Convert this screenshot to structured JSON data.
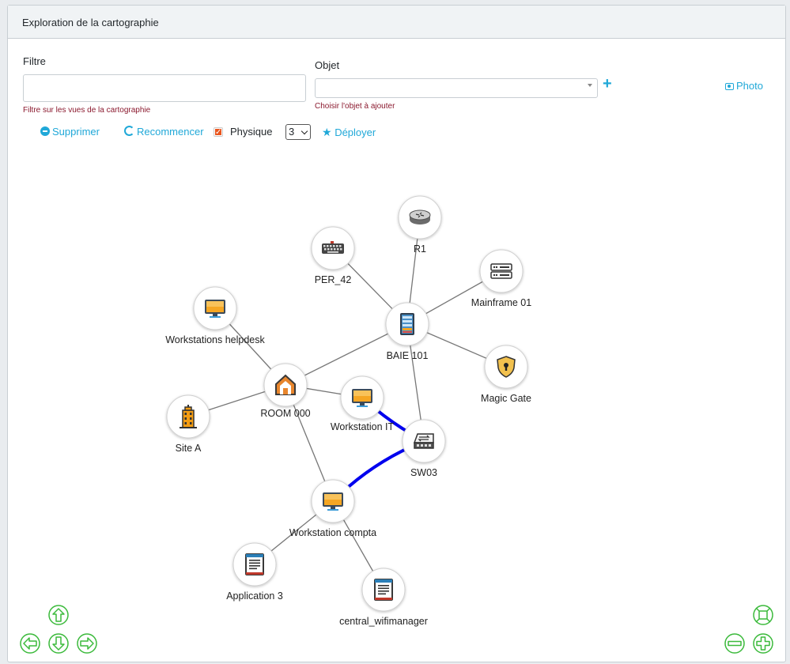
{
  "header": {
    "title": "Exploration de la cartographie"
  },
  "filter": {
    "label": "Filtre",
    "value": "",
    "help": "Filtre sur les vues de la cartographie"
  },
  "object": {
    "label": "Objet",
    "value": "",
    "help": "Choisir l'objet à ajouter"
  },
  "add_button": "+",
  "photo_button": "Photo",
  "toolbar": {
    "delete_label": "Supprimer",
    "restart_label": "Recommencer",
    "physical_label": "Physique",
    "physical_checked": true,
    "depth_value": "3",
    "deploy_label": "Déployer"
  },
  "graph": {
    "nodes": [
      {
        "id": "r1",
        "label": "R1",
        "icon": "router-icon"
      },
      {
        "id": "per42",
        "label": "PER_42",
        "icon": "keyboard-icon"
      },
      {
        "id": "mainframe",
        "label": "Mainframe 01",
        "icon": "server-icon"
      },
      {
        "id": "wshelp",
        "label": "Workstations helpdesk",
        "icon": "monitor-icon"
      },
      {
        "id": "baie",
        "label": "BAIE 101",
        "icon": "rack-icon"
      },
      {
        "id": "magic",
        "label": "Magic Gate",
        "icon": "shield-lock-icon"
      },
      {
        "id": "room",
        "label": "ROOM 000",
        "icon": "house-icon"
      },
      {
        "id": "wsit",
        "label": "Workstation IT",
        "icon": "monitor-icon"
      },
      {
        "id": "sitea",
        "label": "Site A",
        "icon": "building-icon"
      },
      {
        "id": "sw03",
        "label": "SW03",
        "icon": "switch-icon"
      },
      {
        "id": "wscompta",
        "label": "Workstation compta",
        "icon": "monitor-icon"
      },
      {
        "id": "app3",
        "label": "Application 3",
        "icon": "application-icon"
      },
      {
        "id": "wifi",
        "label": "central_wifimanager",
        "icon": "application-icon"
      }
    ],
    "edges": [
      {
        "from": "r1",
        "to": "baie",
        "type": "normal"
      },
      {
        "from": "per42",
        "to": "baie",
        "type": "normal"
      },
      {
        "from": "mainframe",
        "to": "baie",
        "type": "normal"
      },
      {
        "from": "magic",
        "to": "baie",
        "type": "normal"
      },
      {
        "from": "baie",
        "to": "room",
        "type": "normal"
      },
      {
        "from": "baie",
        "to": "sw03",
        "type": "normal"
      },
      {
        "from": "wshelp",
        "to": "room",
        "type": "normal"
      },
      {
        "from": "sitea",
        "to": "room",
        "type": "normal"
      },
      {
        "from": "room",
        "to": "wsit",
        "type": "normal"
      },
      {
        "from": "room",
        "to": "wscompta",
        "type": "normal"
      },
      {
        "from": "wsit",
        "to": "sw03",
        "type": "physical"
      },
      {
        "from": "wscompta",
        "to": "sw03",
        "type": "physical"
      },
      {
        "from": "wscompta",
        "to": "app3",
        "type": "normal"
      },
      {
        "from": "wscompta",
        "to": "wifi",
        "type": "normal"
      }
    ]
  },
  "colors": {
    "accent": "#20a8d8",
    "physical_link": "#0000ee",
    "nav": "#3cba3c",
    "help_text": "#8b1a2f"
  },
  "nav_controls": [
    "arrow-up-icon",
    "arrow-left-icon",
    "arrow-down-icon",
    "arrow-right-icon",
    "fit-view-icon",
    "zoom-out-icon",
    "zoom-in-icon"
  ]
}
